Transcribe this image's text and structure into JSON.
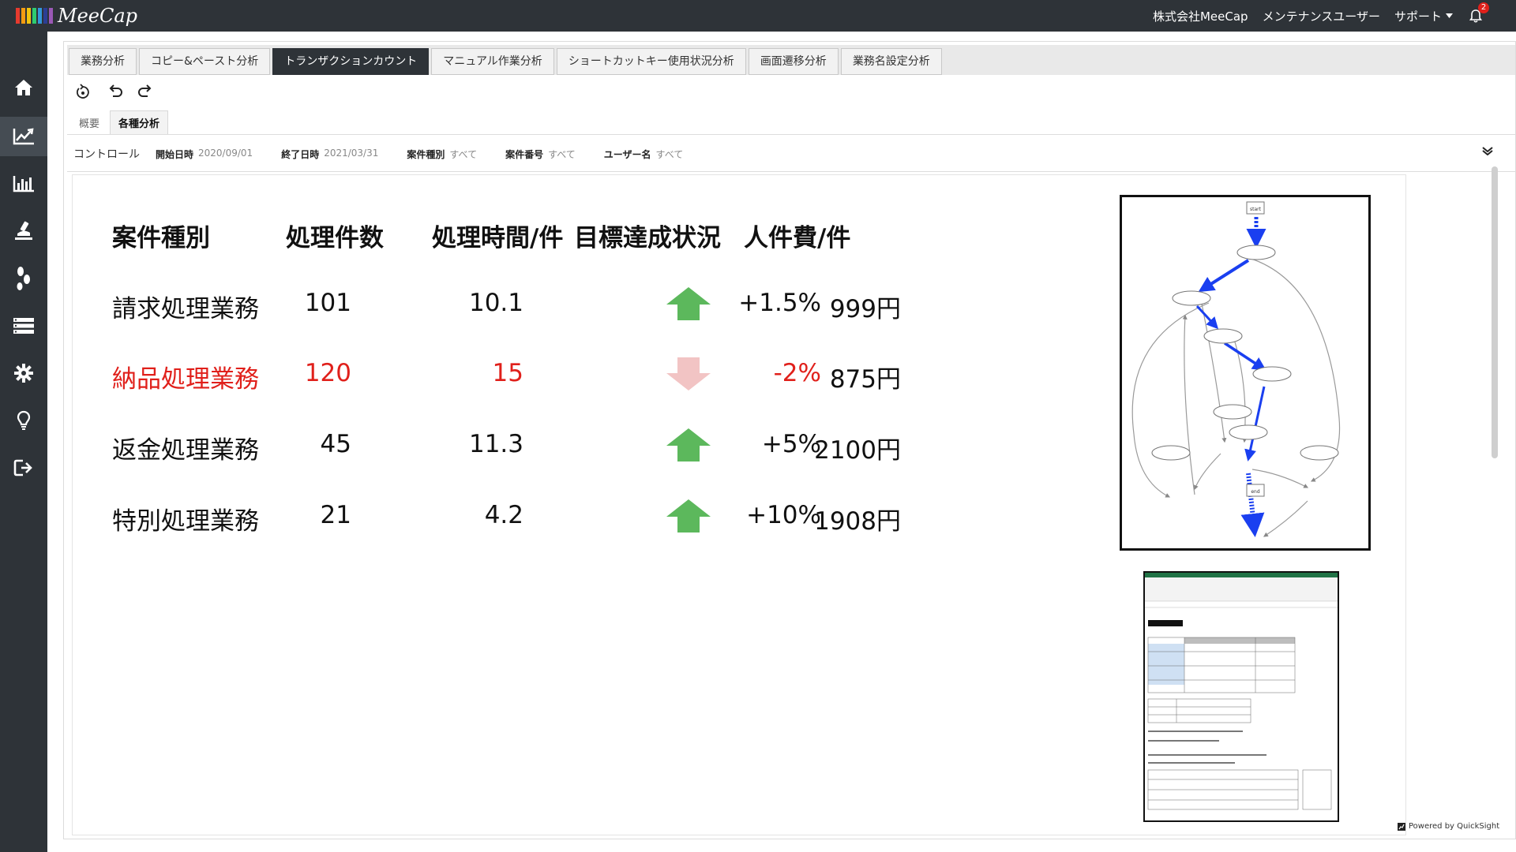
{
  "app": {
    "logo_text": "MeeCap",
    "logo_colors": [
      "#e63b2e",
      "#f39c12",
      "#f1c40f",
      "#2ecc71",
      "#3498db",
      "#2c3e94",
      "#9b59b6"
    ]
  },
  "header": {
    "company": "株式会社MeeCap",
    "user": "メンテナンスユーザー",
    "support": "サポート",
    "notification_count": "2"
  },
  "sidebar": {
    "items": [
      {
        "icon": "home-icon"
      },
      {
        "icon": "line-chart-icon",
        "active": true
      },
      {
        "icon": "bar-chart-icon"
      },
      {
        "icon": "microscope-icon"
      },
      {
        "icon": "footsteps-icon"
      },
      {
        "icon": "list-icon"
      },
      {
        "icon": "gear-icon"
      },
      {
        "icon": "lightbulb-icon"
      },
      {
        "icon": "logout-icon"
      }
    ]
  },
  "tabs": [
    {
      "label": "業務分析"
    },
    {
      "label": "コピー&ペースト分析"
    },
    {
      "label": "トランザクションカウント",
      "active": true
    },
    {
      "label": "マニュアル作業分析"
    },
    {
      "label": "ショートカットキー使用状況分析"
    },
    {
      "label": "画面遷移分析"
    },
    {
      "label": "業務名設定分析"
    }
  ],
  "subtabs": [
    {
      "label": "概要"
    },
    {
      "label": "各種分析",
      "active": true
    }
  ],
  "controls": {
    "title": "コントロール",
    "filters": [
      {
        "label": "開始日時",
        "value": "2020/09/01"
      },
      {
        "label": "終了日時",
        "value": "2021/03/31"
      },
      {
        "label": "案件種別",
        "value": "すべて"
      },
      {
        "label": "案件番号",
        "value": "すべて"
      },
      {
        "label": "ユーザー名",
        "value": "すべて"
      }
    ]
  },
  "kpi": {
    "headers": [
      "案件種別",
      "処理件数",
      "処理時間/件",
      "目標達成状況",
      "人件費/件"
    ],
    "rows": [
      {
        "type": "請求処理業務",
        "count": "101",
        "time": "10.1",
        "trend": "up",
        "change": "+1.5%",
        "cost": "999円",
        "highlight": false
      },
      {
        "type": "納品処理業務",
        "count": "120",
        "time": "15",
        "trend": "down",
        "change": "-2%",
        "cost": "875円",
        "highlight": true
      },
      {
        "type": "返金処理業務",
        "count": "45",
        "time": "11.3",
        "trend": "up",
        "change": "+5%",
        "cost": "2100円",
        "highlight": false
      },
      {
        "type": "特別処理業務",
        "count": "21",
        "time": "4.2",
        "trend": "up",
        "change": "+10%",
        "cost": "1908円",
        "highlight": false
      }
    ],
    "colors": {
      "up": "#5cb85c",
      "down": "#f2c4c4",
      "highlight": "#e0201b"
    }
  },
  "diagram": {
    "start": "start",
    "end": "end"
  },
  "powered_by": "Powered by QuickSight"
}
